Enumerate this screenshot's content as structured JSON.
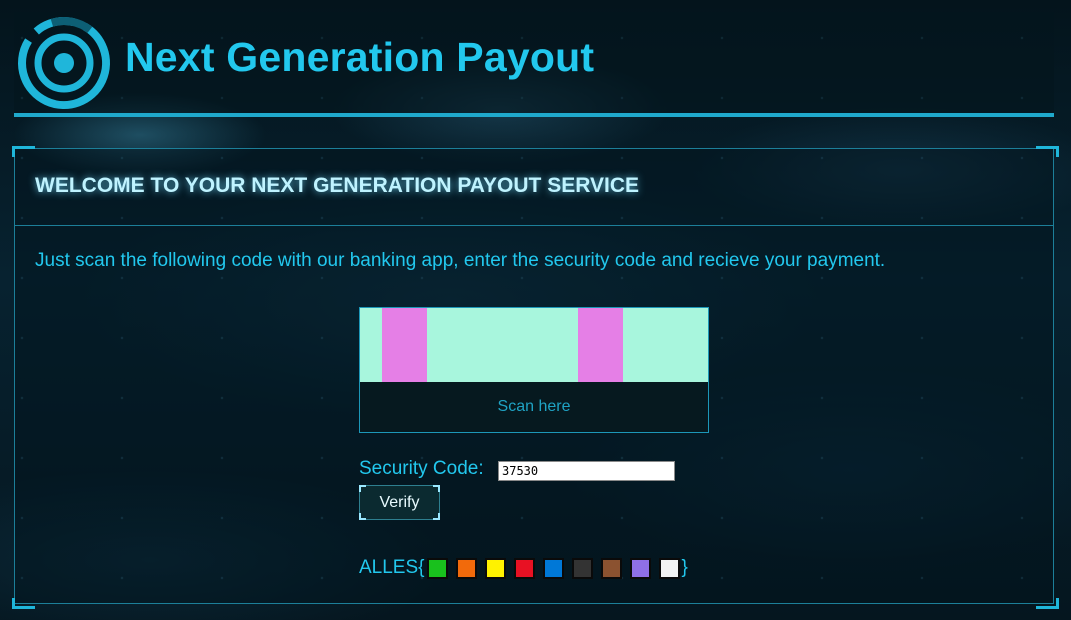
{
  "header": {
    "title": "Next Generation Payout"
  },
  "panel": {
    "heading": "WELCOME TO YOUR NEXT GENERATION PAYOUT SERVICE",
    "instructions": "Just scan the following code with our banking app, enter the security code and recieve your payment."
  },
  "scan": {
    "label": "Scan here",
    "code_colors": {
      "background": "#a8f6dd",
      "bar": "#e57fe6"
    }
  },
  "security": {
    "label": "Security Code:",
    "value": "37530",
    "verify_label": "Verify"
  },
  "flag": {
    "prefix": "ALLES{",
    "suffix": "}",
    "colors": [
      "#19c11d",
      "#f26a0b",
      "#fff200",
      "#e81123",
      "#0078d7",
      "#333333",
      "#8b5230",
      "#8f6fe6",
      "#f2f2f2"
    ]
  },
  "theme": {
    "accent": "#22c8ee",
    "heading_glow": "#bff3ff"
  }
}
